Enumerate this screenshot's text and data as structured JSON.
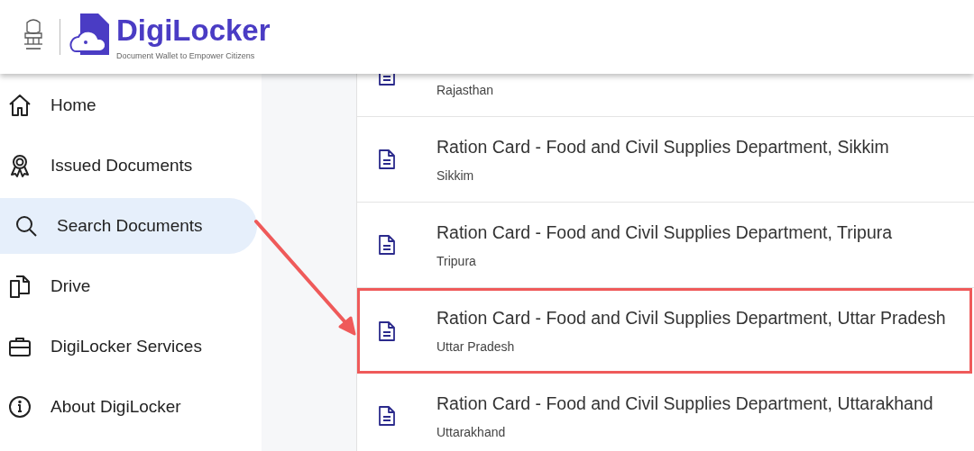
{
  "header": {
    "brand": "DigiLocker",
    "tagline": "Document Wallet to Empower Citizens"
  },
  "sidebar": {
    "items": [
      {
        "label": "Home",
        "selected": false
      },
      {
        "label": "Issued Documents",
        "selected": false
      },
      {
        "label": "Search Documents",
        "selected": true
      },
      {
        "label": "Drive",
        "selected": false
      },
      {
        "label": "DigiLocker Services",
        "selected": false
      },
      {
        "label": "About DigiLocker",
        "selected": false
      }
    ]
  },
  "results": [
    {
      "subtitle": "Rajasthan",
      "highlighted": false
    },
    {
      "title": "Ration Card - Food and Civil Supplies Department, Sikkim",
      "subtitle": "Sikkim",
      "highlighted": false
    },
    {
      "title": "Ration Card - Food and Civil Supplies Department, Tripura",
      "subtitle": "Tripura",
      "highlighted": false
    },
    {
      "title": "Ration Card - Food and Civil Supplies Department, Uttar Pradesh",
      "subtitle": "Uttar Pradesh",
      "highlighted": true
    },
    {
      "title": "Ration Card - Food and Civil Supplies Department, Uttarakhand",
      "subtitle": "Uttarakhand",
      "highlighted": false
    }
  ]
}
